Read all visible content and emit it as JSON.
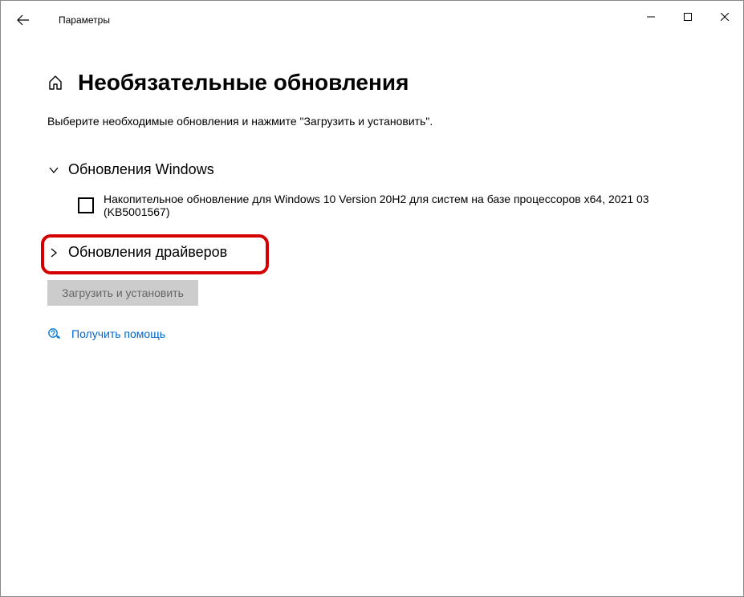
{
  "window": {
    "app_title": "Параметры"
  },
  "page": {
    "title": "Необязательные обновления",
    "description": "Выберите необходимые обновления и нажмите \"Загрузить и установить\"."
  },
  "sections": {
    "windows_updates": {
      "title": "Обновления Windows",
      "items": [
        {
          "label": "Накопительное обновление для Windows 10 Version 20H2 для систем на базе процессоров x64, 2021 03 (KB5001567)"
        }
      ]
    },
    "driver_updates": {
      "title": "Обновления драйверов"
    }
  },
  "buttons": {
    "download_install": "Загрузить и установить"
  },
  "help": {
    "label": "Получить помощь"
  }
}
